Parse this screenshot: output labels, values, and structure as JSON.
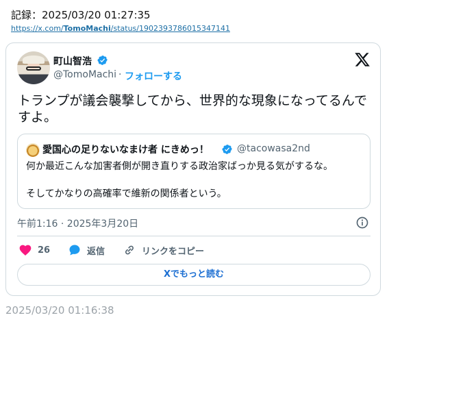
{
  "record": {
    "label": "記録：2025/03/20 01:27:35"
  },
  "source": {
    "url_prefix": "https://x.com/",
    "url_user": "TomoMachi",
    "url_suffix": "/status/1902393786015347141"
  },
  "tweet": {
    "author_name": "町山智浩",
    "author_handle": "@TomoMachi",
    "separator": "·",
    "follow_label": "フォローする",
    "text": "トランプが議会襲撃してから、世界的な現象になってるんですよ。",
    "timestamp": "午前1:16 · 2025年3月20日",
    "likes": "26",
    "reply_label": "返信",
    "copy_link_label": "リンクをコピー",
    "read_more_label": "Xでもっと読む"
  },
  "quote": {
    "author_name": "愛国心の足りないなまけ者 にきめっ！",
    "author_handle": "@tacowasa2nd",
    "text": "何か最近こんな加害者側が開き直りする政治家ばっか見る気がするな。\n\nそしてかなりの高確率で維新の関係者という。"
  },
  "footer": {
    "date": "2025/03/20 01:16:38"
  },
  "colors": {
    "accent": "#1d9bf0",
    "like": "#f91880",
    "muted": "#536471",
    "border": "#cfd9de"
  },
  "icons": {
    "verified": "verified-badge-icon",
    "logo": "x-logo-icon",
    "info": "info-icon",
    "like": "heart-icon",
    "reply": "speech-bubble-icon",
    "copy": "link-icon"
  }
}
